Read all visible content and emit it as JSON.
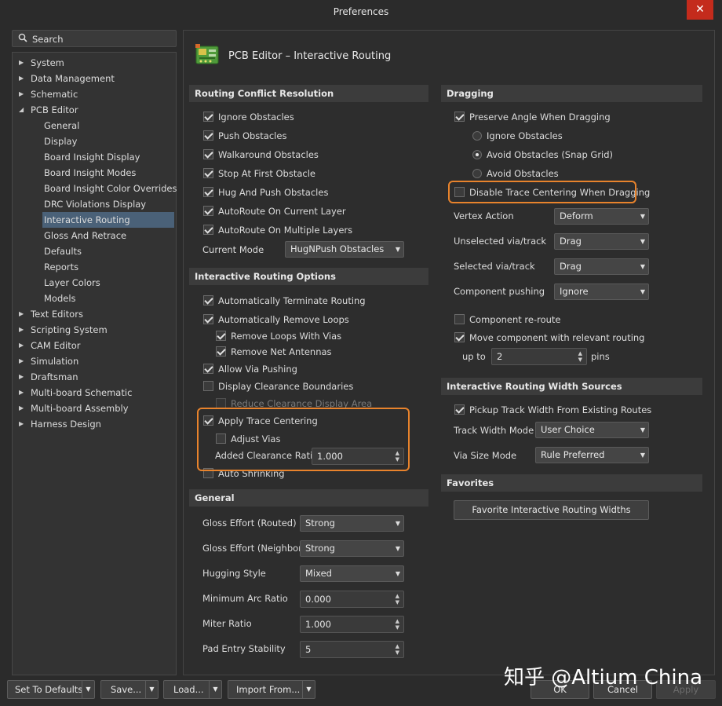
{
  "window": {
    "title": "Preferences",
    "close_label": "✕"
  },
  "search": {
    "placeholder": "Search"
  },
  "tree": [
    {
      "label": "System",
      "level": 0,
      "arrow": "▶"
    },
    {
      "label": "Data Management",
      "level": 0,
      "arrow": "▶"
    },
    {
      "label": "Schematic",
      "level": 0,
      "arrow": "▶"
    },
    {
      "label": "PCB Editor",
      "level": 0,
      "arrow": "◢"
    },
    {
      "label": "General",
      "level": 1
    },
    {
      "label": "Display",
      "level": 1
    },
    {
      "label": "Board Insight Display",
      "level": 1
    },
    {
      "label": "Board Insight Modes",
      "level": 1
    },
    {
      "label": "Board Insight Color Overrides",
      "level": 1
    },
    {
      "label": "DRC Violations Display",
      "level": 1
    },
    {
      "label": "Interactive Routing",
      "level": 1,
      "selected": true
    },
    {
      "label": "Gloss And Retrace",
      "level": 1
    },
    {
      "label": "Defaults",
      "level": 1
    },
    {
      "label": "Reports",
      "level": 1
    },
    {
      "label": "Layer Colors",
      "level": 1
    },
    {
      "label": "Models",
      "level": 1
    },
    {
      "label": "Text Editors",
      "level": 0,
      "arrow": "▶"
    },
    {
      "label": "Scripting System",
      "level": 0,
      "arrow": "▶"
    },
    {
      "label": "CAM Editor",
      "level": 0,
      "arrow": "▶"
    },
    {
      "label": "Simulation",
      "level": 0,
      "arrow": "▶"
    },
    {
      "label": "Draftsman",
      "level": 0,
      "arrow": "▶"
    },
    {
      "label": "Multi-board Schematic",
      "level": 0,
      "arrow": "▶"
    },
    {
      "label": "Multi-board Assembly",
      "level": 0,
      "arrow": "▶"
    },
    {
      "label": "Harness Design",
      "level": 0,
      "arrow": "▶"
    }
  ],
  "page": {
    "title": "PCB Editor – Interactive Routing",
    "icon": "pcb-board-icon"
  },
  "conflict": {
    "heading": "Routing Conflict Resolution",
    "items": [
      {
        "label": "Ignore Obstacles",
        "checked": true
      },
      {
        "label": "Push Obstacles",
        "checked": true
      },
      {
        "label": "Walkaround Obstacles",
        "checked": true
      },
      {
        "label": "Stop At First Obstacle",
        "checked": true
      },
      {
        "label": "Hug And Push Obstacles",
        "checked": true
      },
      {
        "label": "AutoRoute On Current Layer",
        "checked": true
      },
      {
        "label": "AutoRoute On Multiple Layers",
        "checked": true
      }
    ],
    "current_mode_label": "Current Mode",
    "current_mode_value": "HugNPush Obstacles"
  },
  "options": {
    "heading": "Interactive Routing Options",
    "auto_terminate": "Automatically Terminate Routing",
    "auto_remove_loops": "Automatically Remove Loops",
    "remove_loops_vias": "Remove Loops With Vias",
    "remove_net_antennas": "Remove Net Antennas",
    "allow_via_pushing": "Allow Via Pushing",
    "display_clearance": "Display Clearance Boundaries",
    "reduce_clearance": "Reduce Clearance Display Area",
    "apply_trace_centering": "Apply Trace Centering",
    "adjust_vias": "Adjust Vias",
    "added_clearance_label": "Added Clearance Ratio",
    "added_clearance_value": "1.000",
    "auto_shrinking": "Auto Shrinking"
  },
  "general": {
    "heading": "General",
    "rows": [
      {
        "label": "Gloss Effort (Routed)",
        "value": "Strong",
        "kind": "dropdown"
      },
      {
        "label": "Gloss Effort (Neighbor)",
        "value": "Strong",
        "kind": "dropdown"
      },
      {
        "label": "Hugging Style",
        "value": "Mixed",
        "kind": "dropdown"
      },
      {
        "label": "Minimum Arc Ratio",
        "value": "0.000",
        "kind": "spin"
      },
      {
        "label": "Miter Ratio",
        "value": "1.000",
        "kind": "spin"
      },
      {
        "label": "Pad Entry Stability",
        "value": "5",
        "kind": "spin"
      }
    ]
  },
  "dragging": {
    "heading": "Dragging",
    "preserve_angle": "Preserve Angle When Dragging",
    "ignore_obstacles": "Ignore Obstacles",
    "avoid_snap": "Avoid Obstacles (Snap Grid)",
    "avoid_obstacles": "Avoid Obstacles",
    "disable_trace_centering": "Disable Trace Centering When Dragging",
    "rows": [
      {
        "label": "Vertex Action",
        "value": "Deform"
      },
      {
        "label": "Unselected via/track",
        "value": "Drag"
      },
      {
        "label": "Selected via/track",
        "value": "Drag"
      },
      {
        "label": "Component pushing",
        "value": "Ignore"
      }
    ],
    "component_reroute": "Component re-route",
    "move_component": "Move component with relevant routing",
    "up_to_label": "up to",
    "up_to_value": "2",
    "pins_label": "pins"
  },
  "width_sources": {
    "heading": "Interactive Routing Width Sources",
    "pickup": "Pickup Track Width From Existing Routes",
    "track_width_mode_label": "Track Width Mode",
    "track_width_mode_value": "User Choice",
    "via_size_mode_label": "Via Size Mode",
    "via_size_mode_value": "Rule Preferred"
  },
  "favorites": {
    "heading": "Favorites",
    "button": "Favorite Interactive Routing Widths"
  },
  "footer": {
    "set_defaults": "Set To Defaults",
    "save": "Save...",
    "load": "Load...",
    "import_from": "Import From...",
    "ok": "OK",
    "cancel": "Cancel",
    "apply": "Apply",
    "split_caret": "▼"
  },
  "watermark": "知乎 @Altium China",
  "colors": {
    "highlight": "#e8832c",
    "selection": "#4a6178",
    "close": "#c42b1c"
  }
}
